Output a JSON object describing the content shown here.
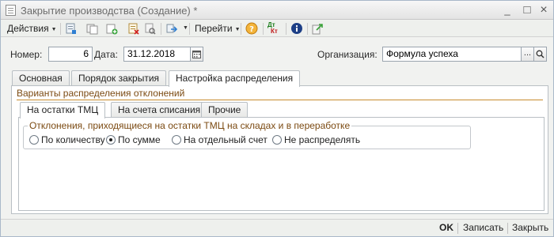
{
  "window": {
    "title": "Закрытие производства (Создание) *",
    "controls": {
      "minimize": "_",
      "maximize": "□",
      "close": "×"
    }
  },
  "toolbar": {
    "actions_label": "Действия",
    "goto_label": "Перейти",
    "icons": [
      "post-icon",
      "copy-icon",
      "add-copy-icon",
      "delete-icon",
      "find-icon",
      "structure-icon",
      "help-icon",
      "dt-kt-icon",
      "info-icon",
      "export-icon"
    ],
    "dtkt_top": "Дт",
    "dtkt_bottom": "Кт"
  },
  "header": {
    "number_label": "Номер:",
    "number_value": "6",
    "date_label": "Дата:",
    "date_value": "31.12.2018",
    "organization_label": "Организация:",
    "organization_value": "Формула успеха",
    "select_button": "...",
    "open_button": "Q"
  },
  "tabs": [
    {
      "label": "Основная",
      "active": false
    },
    {
      "label": "Порядок закрытия",
      "active": false
    },
    {
      "label": "Настройка распределения",
      "active": true
    }
  ],
  "section_title": "Варианты распределения отклонений",
  "subtabs": [
    {
      "label": "На остатки ТМЦ",
      "active": true
    },
    {
      "label": "На счета списания",
      "active": false
    },
    {
      "label": "Прочие",
      "active": false
    }
  ],
  "group": {
    "title": "Отклонения, приходящиеся на остатки ТМЦ на складах и в переработке",
    "options": [
      {
        "label": "По количеству",
        "selected": false
      },
      {
        "label": "По сумме",
        "selected": true
      },
      {
        "label": "На отдельный счет",
        "selected": false
      },
      {
        "label": "Не распределять",
        "selected": false
      }
    ]
  },
  "bottom": {
    "ok_label": "OK",
    "save_label": "Записать",
    "close_label": "Закрыть"
  },
  "colors": {
    "accent_text": "#7b4a12",
    "accent_line": "#c78b2f",
    "window_bg": "#f1f2f0"
  }
}
